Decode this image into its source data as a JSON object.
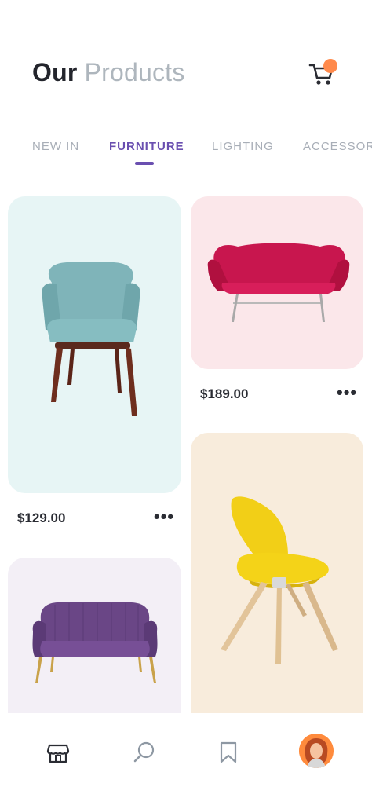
{
  "header": {
    "title_part1": "Our",
    "title_part2": "Products"
  },
  "cart": {
    "icon": "cart-icon",
    "badge_color": "#ff8a4c"
  },
  "tabs": [
    {
      "label": "NEW IN",
      "active": false
    },
    {
      "label": "FURNITURE",
      "active": true
    },
    {
      "label": "LIGHTING",
      "active": false
    },
    {
      "label": "ACCESSORIES",
      "active": false
    }
  ],
  "products": [
    {
      "name": "armchair",
      "price": "$129.00",
      "bg": "#e7f5f5"
    },
    {
      "name": "sofa",
      "price": "$189.00",
      "bg": "#fbe7ea"
    },
    {
      "name": "loveseat",
      "price": "",
      "bg": "#f3eff6"
    },
    {
      "name": "yellow-chair",
      "price": "",
      "bg": "#f8ecdc"
    }
  ],
  "more_label": "•••",
  "bottom_nav": [
    {
      "icon": "store-icon"
    },
    {
      "icon": "search-icon"
    },
    {
      "icon": "bookmark-icon"
    },
    {
      "icon": "avatar"
    }
  ],
  "colors": {
    "accent": "#6a4fb0",
    "text_dark": "#23252c",
    "text_muted": "#aeb6bd"
  }
}
